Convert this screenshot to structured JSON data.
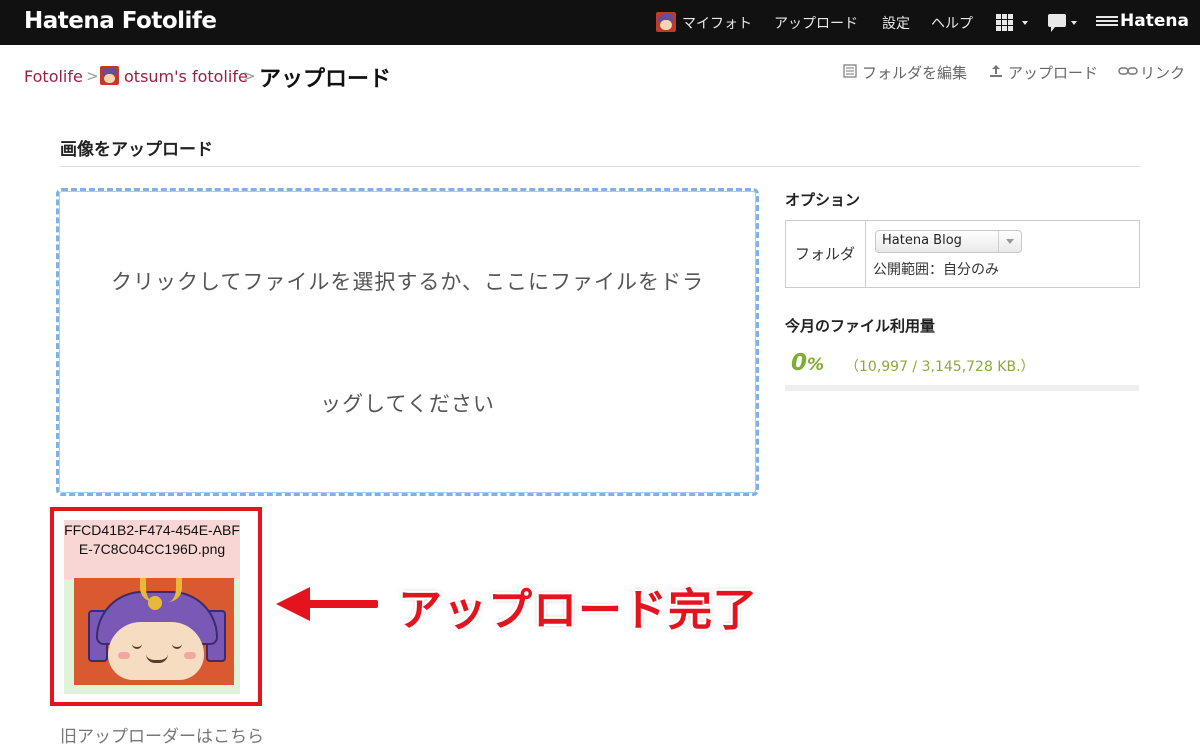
{
  "header": {
    "logo": "Hatena Fotolife",
    "nav": {
      "my_foto": "マイフォト",
      "upload": "アップロード",
      "settings": "設定",
      "help": "ヘルプ",
      "brand": "Hatena"
    },
    "icons": [
      "avatar",
      "grid-menu-icon",
      "notification-bubble-icon",
      "hatena-mark-icon"
    ]
  },
  "breadcrumb": {
    "root": "Fotolife",
    "separator": ">",
    "user": "otsum's fotolife",
    "current": "アップロード"
  },
  "actions": {
    "edit_folder": "フォルダを編集",
    "upload": "アップロード",
    "link": "リンク"
  },
  "section": {
    "title": "画像をアップロード"
  },
  "dropzone": {
    "line1": "クリックしてファイルを選択するか、ここにファイルをドラ",
    "line2": "ッグしてください",
    "border_color": "#7fb0e6"
  },
  "options": {
    "title": "オプション",
    "folder_label": "フォルダ",
    "folder_selected": "Hatena Blog",
    "visibility": "公開範囲：自分のみ"
  },
  "usage": {
    "title": "今月のファイル利用量",
    "percent": "0",
    "percent_unit": "%",
    "detail": "（10,997 / 3,145,728 KB.）",
    "color": "#7cae2f"
  },
  "uploaded": {
    "filename": "FFCD41B2-F474-454E-ABFE-7C8C04CC196D.png",
    "highlight_color": "#e4141e"
  },
  "annotation": {
    "text": "アップロード完了"
  },
  "footer": {
    "old_uploader": "旧アップローダーはこちら"
  }
}
